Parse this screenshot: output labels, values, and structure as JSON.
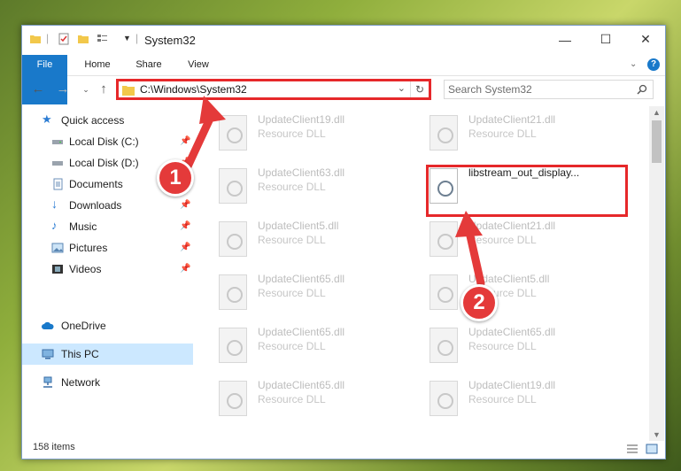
{
  "window": {
    "title": "System32",
    "controls": {
      "minimize": "—",
      "maximize": "☐",
      "close": "✕"
    }
  },
  "ribbon": {
    "tabs": [
      "File",
      "Home",
      "Share",
      "View"
    ]
  },
  "address": {
    "path": "C:\\Windows\\System32",
    "search_placeholder": "Search System32"
  },
  "sidebar": {
    "items": [
      {
        "label": "Quick access",
        "icon": "star-icon",
        "pinned": false
      },
      {
        "label": "Local Disk (C:)",
        "icon": "drive-icon",
        "pinned": true
      },
      {
        "label": "Local Disk (D:)",
        "icon": "drive-icon",
        "pinned": true
      },
      {
        "label": "Documents",
        "icon": "documents-icon",
        "pinned": true
      },
      {
        "label": "Downloads",
        "icon": "download-icon",
        "pinned": true
      },
      {
        "label": "Music",
        "icon": "music-icon",
        "pinned": true
      },
      {
        "label": "Pictures",
        "icon": "pictures-icon",
        "pinned": true
      },
      {
        "label": "Videos",
        "icon": "videos-icon",
        "pinned": true
      },
      {
        "label": "OneDrive",
        "icon": "cloud-icon",
        "pinned": false
      },
      {
        "label": "This PC",
        "icon": "computer-icon",
        "pinned": false,
        "selected": true
      },
      {
        "label": "Network",
        "icon": "network-icon",
        "pinned": false
      }
    ]
  },
  "files": [
    {
      "name": "UpdateClient19.dll",
      "type": "Resource DLL"
    },
    {
      "name": "UpdateClient21.dll",
      "type": "Resource DLL"
    },
    {
      "name": "UpdateClient63.dll",
      "type": "Resource DLL"
    },
    {
      "name": "libstream_out_display...",
      "type": "",
      "highlighted": true
    },
    {
      "name": "UpdateClient5.dll",
      "type": "Resource DLL"
    },
    {
      "name": "UpdateClient21.dll",
      "type": "Resource DLL"
    },
    {
      "name": "UpdateClient65.dll",
      "type": "Resource DLL"
    },
    {
      "name": "UpdateClient5.dll",
      "type": "Resource DLL"
    },
    {
      "name": "UpdateClient65.dll",
      "type": "Resource DLL"
    },
    {
      "name": "UpdateClient65.dll",
      "type": "Resource DLL"
    },
    {
      "name": "UpdateClient65.dll",
      "type": "Resource DLL"
    },
    {
      "name": "UpdateClient19.dll",
      "type": "Resource DLL"
    }
  ],
  "status": {
    "item_count": "158 items"
  },
  "callouts": [
    "1",
    "2"
  ],
  "colors": {
    "accent": "#1979ca",
    "highlight": "#e6282a",
    "selection": "#cce8ff"
  }
}
